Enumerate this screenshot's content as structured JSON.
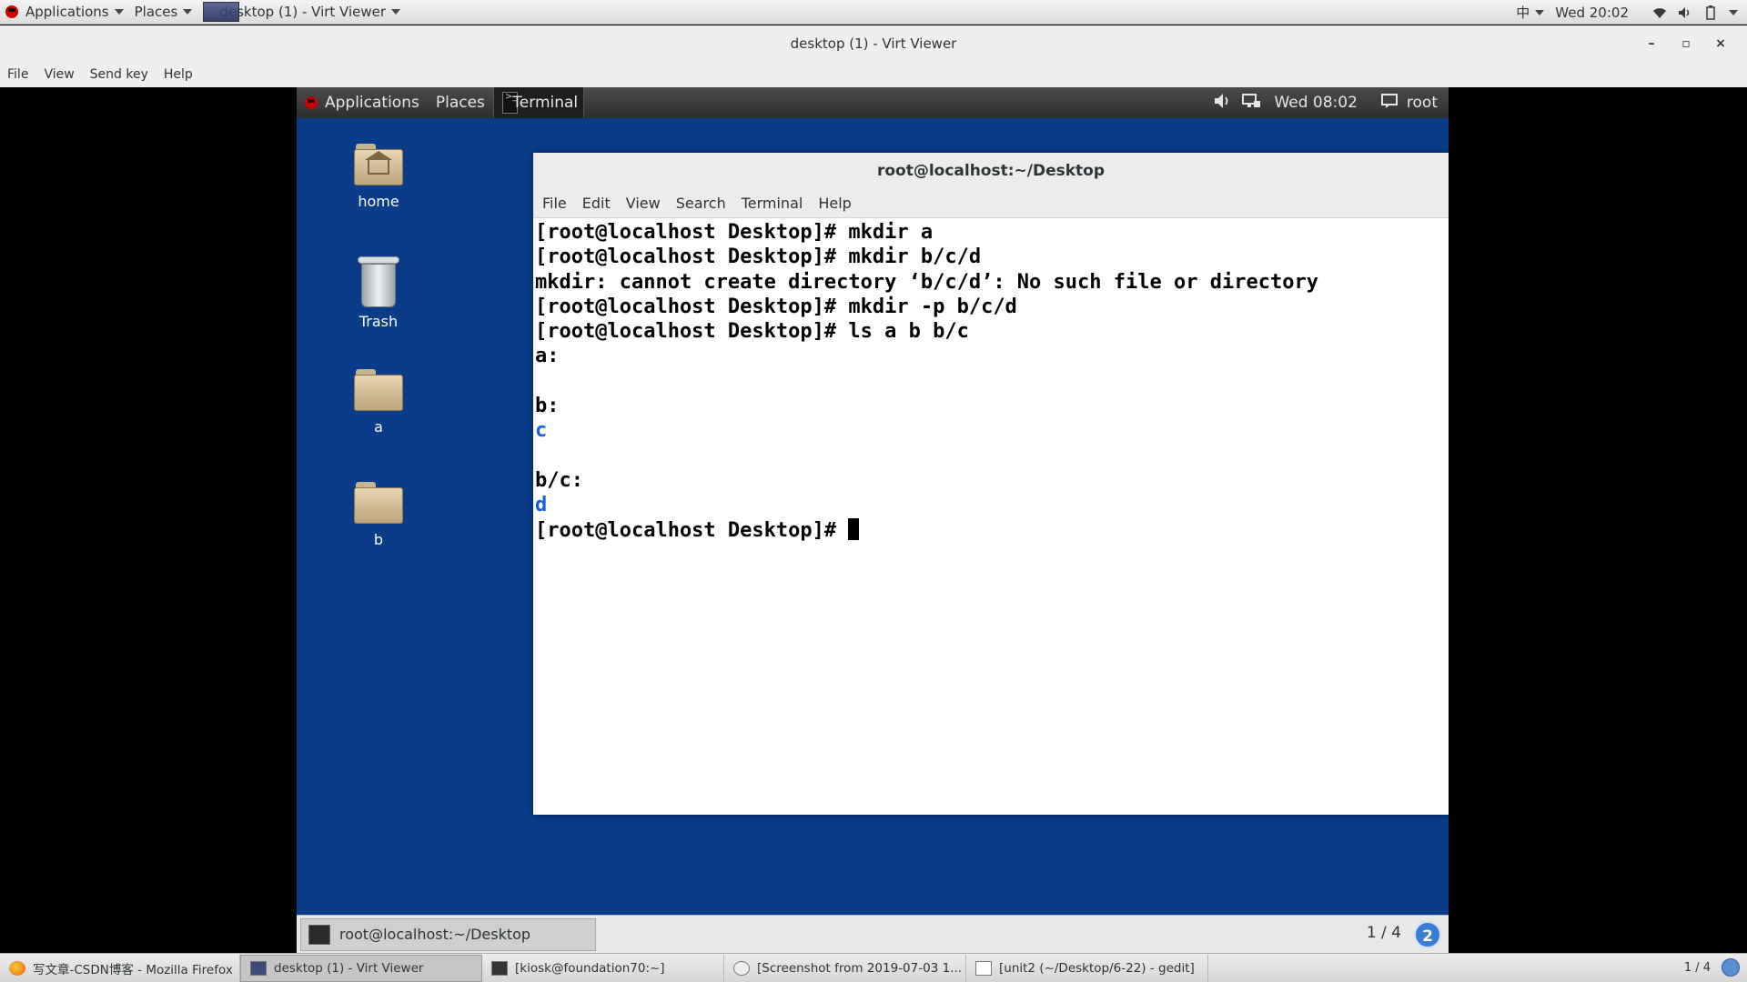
{
  "host_panel": {
    "applications": "Applications",
    "places": "Places",
    "window_name": "desktop (1) - Virt Viewer",
    "input_method": "中",
    "clock": "Wed 20:02"
  },
  "window": {
    "title": "desktop (1) - Virt Viewer",
    "minimize": "–",
    "maximize": "▫",
    "close": "×"
  },
  "menubar": {
    "file": "File",
    "view": "View",
    "send_key": "Send key",
    "help": "Help"
  },
  "guest": {
    "panel": {
      "applications": "Applications",
      "places": "Places",
      "terminal": "Terminal",
      "clock": "Wed 08:02",
      "user": "root"
    },
    "desktop_icons": [
      {
        "label": "home"
      },
      {
        "label": "Trash"
      },
      {
        "label": "a"
      },
      {
        "label": "b"
      }
    ],
    "terminal": {
      "title": "root@localhost:~/Desktop",
      "menu": [
        "File",
        "Edit",
        "View",
        "Search",
        "Terminal",
        "Help"
      ],
      "lines": [
        "[root@localhost Desktop]# mkdir a",
        "[root@localhost Desktop]# mkdir b/c/d",
        "mkdir: cannot create directory ‘b/c/d’: No such file or directory",
        "[root@localhost Desktop]# mkdir -p b/c/d",
        "[root@localhost Desktop]# ls a b b/c",
        "a:",
        "",
        "b:",
        "c",
        "",
        "b/c:",
        "d",
        "[root@localhost Desktop]# "
      ]
    },
    "bottom_bar": {
      "task": "root@localhost:~/Desktop",
      "pager": "1 / 4",
      "help": "2"
    }
  },
  "host_taskbar": {
    "tasks": [
      "写文章-CSDN博客 - Mozilla Firefox",
      "desktop (1) - Virt Viewer",
      "[kiosk@foundation70:~]",
      "[Screenshot from 2019-07-03 1...",
      "[unit2 (~/Desktop/6-22) - gedit]"
    ],
    "pager": "1 / 4"
  }
}
